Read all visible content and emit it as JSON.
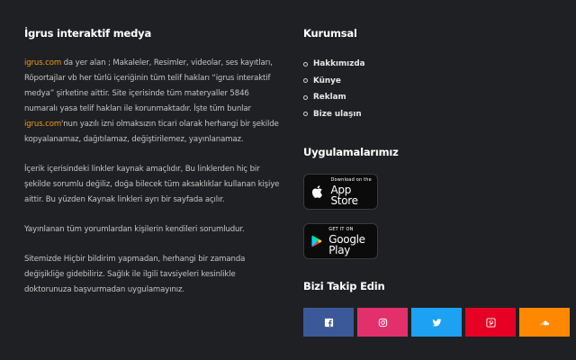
{
  "about": {
    "title": "İgrus interaktif medya",
    "p1_link1": "igrus.com",
    "p1_text1": " da yer alan ; Makaleler, Resimler, videolar, ses kayıtları, Röportajlar vb her türlü içeriğinin tüm telif hakları “igrus interaktif medya” şirketine aittir. Site içerisinde tüm materyaller 5846 numaralı yasa telif hakları ile korunmaktadır. İşte tüm bunlar ",
    "p1_link2": "igrus.com",
    "p1_text2": "'nun yazılı izni olmaksızın ticari olarak herhangi bir şekilde kopyalanamaz, dağıtılamaz, değiştirilemez, yayınlanamaz.",
    "p2": "İçerik içerisindeki linkler kaynak amaçlıdır, Bu linklerden hiç bir şekilde sorumlu değiliz, doğa bilecek tüm aksaklıklar kullanan kişiye aittir. Bu yüzden Kaynak linkleri ayrı bir sayfada açılır.",
    "p3": "Yayınlanan tüm yorumlardan kişilerin kendileri sorumludur.",
    "p4": "Sitemizde Hiçbir bildirim yapmadan, herhangi bir zamanda değişikliğe gidebiliriz. Sağlık ile ilgili tavsiyeleri kesinlikle doktorunuza başvurmadan uygulamayınız."
  },
  "corporate": {
    "title": "Kurumsal",
    "links": [
      "Hakkımızda",
      "Künye",
      "Reklam",
      "Bize ulaşın"
    ]
  },
  "apps": {
    "title": "Uygulamalarımız",
    "appstore_small": "Download on the",
    "appstore_big": "App Store",
    "googleplay_small": "GET IT ON",
    "googleplay_big": "Google Play"
  },
  "follow": {
    "title": "Bizi Takip Edin",
    "colors": {
      "facebook": "#3b5998",
      "instagram": "#e1306c",
      "twitter": "#1da1f2",
      "pinterest": "#e60023",
      "soundcloud": "#ff8800"
    }
  },
  "accent_color": "#f39c12"
}
